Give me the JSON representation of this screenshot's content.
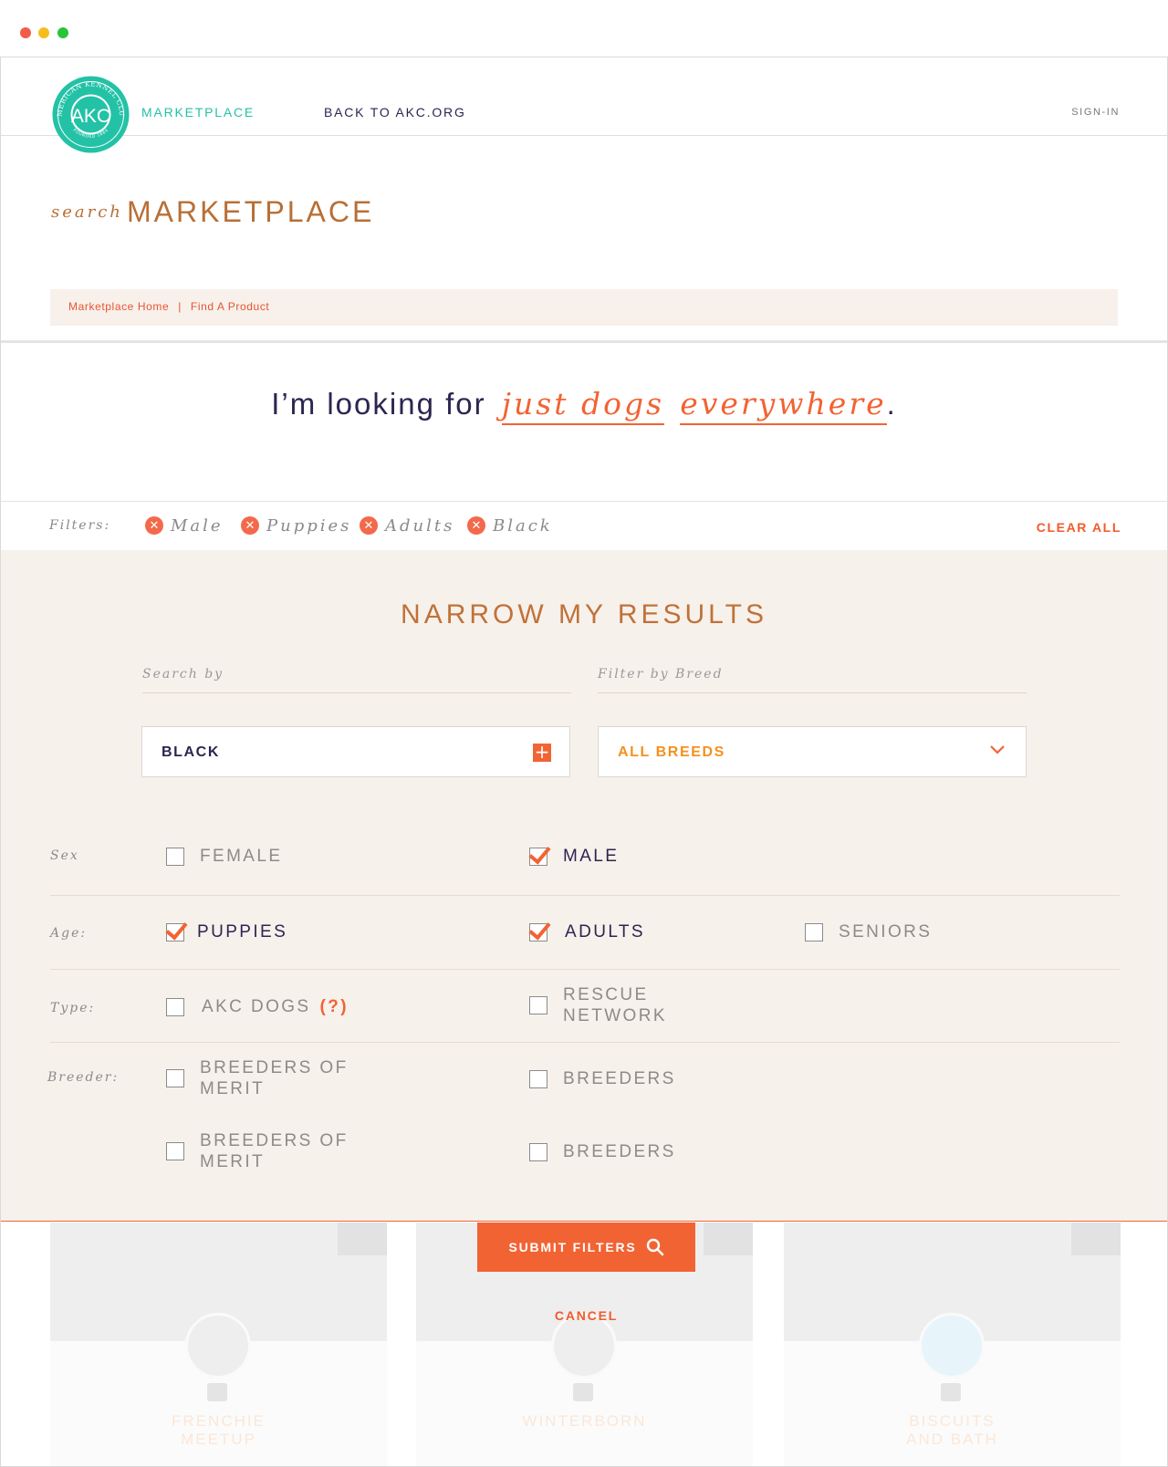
{
  "header": {
    "logo_text": "AKC",
    "logo_ring_text": "AMERICAN KENNEL CLUB",
    "logo_founded": "FOUNDED 1884",
    "marketplace_link": "MARKETPLACE",
    "back_link": "BACK TO AKC.ORG",
    "signin_link": "SIGN-IN"
  },
  "title": {
    "prefix": "search",
    "main": "MARKETPLACE"
  },
  "breadcrumb": {
    "items": [
      "Marketplace Home",
      "Find A Product"
    ],
    "separator": "|"
  },
  "headline": {
    "lead": "I’m looking for",
    "pick1": "just dogs",
    "pick2": "everywhere",
    "end": "."
  },
  "filters": {
    "label": "Filters:",
    "chips": [
      "Male",
      "Puppies",
      "Adults",
      "Black"
    ],
    "remove_icon": "close-icon",
    "clear_all": "CLEAR ALL"
  },
  "narrow": {
    "title": "NARROW MY RESULTS",
    "search_by_label": "Search by",
    "search_by_value": "BLACK",
    "filter_breed_label": "Filter by Breed",
    "filter_breed_value": "ALL BREEDS",
    "rows": {
      "sex": {
        "label": "Sex",
        "options": [
          {
            "label": "FEMALE",
            "checked": false
          },
          {
            "label": "MALE",
            "checked": true
          }
        ]
      },
      "age": {
        "label": "Age:",
        "options": [
          {
            "label": "PUPPIES",
            "checked": true
          },
          {
            "label": "ADULTS",
            "checked": true
          },
          {
            "label": "SENIORS",
            "checked": false
          }
        ]
      },
      "type": {
        "label": "Type:",
        "options": [
          {
            "label": "AKC DOGS",
            "extra": "(?)",
            "checked": false
          },
          {
            "label": "RESCUE\nNETWORK",
            "checked": false
          }
        ]
      },
      "breeder": {
        "label": "Breeder:",
        "options": [
          {
            "label": "BREEDERS OF\nMERIT",
            "checked": false
          },
          {
            "label": "BREEDERS",
            "checked": false
          },
          {
            "label": "BREEDERS OF\nMERIT",
            "checked": false
          },
          {
            "label": "BREEDERS",
            "checked": false
          }
        ]
      }
    },
    "submit_label": "SUBMIT FILTERS",
    "cancel_label": "CANCEL"
  },
  "cards": [
    {
      "name": "FRENCHIE\nMEETUP"
    },
    {
      "name": "WINTERBORN"
    },
    {
      "name": "BISCUITS\nAND BATH"
    }
  ],
  "colors": {
    "accent": "#f26333",
    "brand_teal": "#23c2a6",
    "title_brown": "#b86f36",
    "panel_bg": "#f7f1ec",
    "navy": "#2d2550"
  }
}
